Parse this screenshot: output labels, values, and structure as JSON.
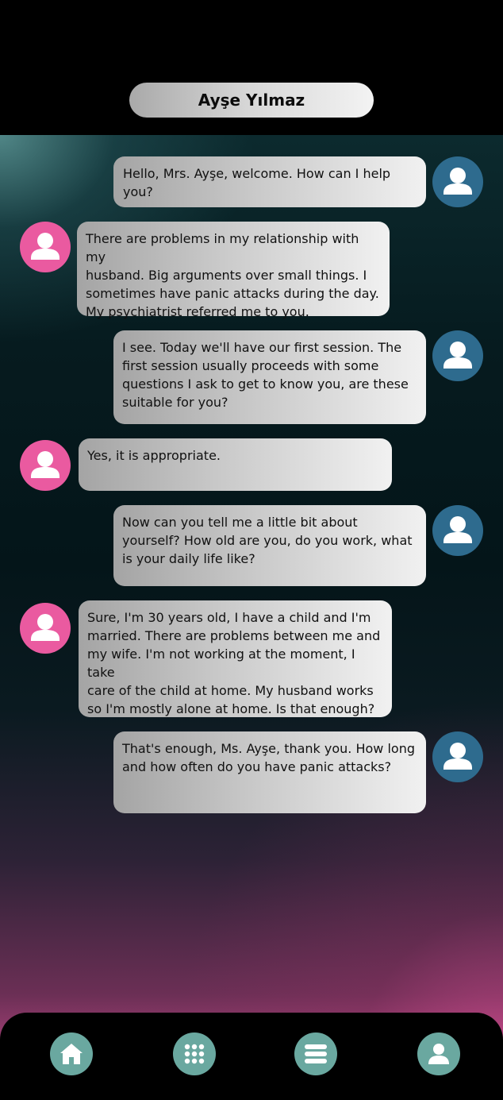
{
  "header": {
    "title": "Ayşe Yılmaz"
  },
  "messages": [
    {
      "sender": "therapist",
      "text": "Hello, Mrs. Ayşe, welcome. How can I help\nyou?"
    },
    {
      "sender": "client",
      "text": "There are problems in my relationship with my\nhusband. Big arguments over small things. I\nsometimes have panic attacks during the day.\nMy psychiatrist referred me to you."
    },
    {
      "sender": "therapist",
      "text": "I see. Today we'll have our first session. The\nfirst session usually proceeds with some\nquestions I ask to get to know you, are these\nsuitable for you?"
    },
    {
      "sender": "client",
      "text": "Yes, it is appropriate."
    },
    {
      "sender": "therapist",
      "text": "Now can you tell me a little bit about\nyourself? How old are you, do you work, what\nis your daily life like?"
    },
    {
      "sender": "client",
      "text": "Sure, I'm 30 years old, I have a child and I'm\nmarried. There are problems between me and\nmy wife. I'm not working at the moment, I take\ncare of the child at home. My husband works\nso I'm mostly alone at home. Is that enough?"
    },
    {
      "sender": "therapist",
      "text": "That's enough, Ms. Ayşe, thank you. How long\nand how often do you have panic attacks?"
    }
  ],
  "nav": [
    {
      "icon": "home-icon"
    },
    {
      "icon": "grid-icon"
    },
    {
      "icon": "menu-icon"
    },
    {
      "icon": "profile-icon"
    }
  ],
  "colors": {
    "therapist_avatar": "#2e6b8e",
    "client_avatar": "#ea5aa0",
    "nav_button": "#6aa8a0"
  }
}
